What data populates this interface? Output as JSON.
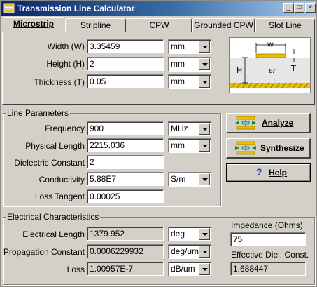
{
  "window": {
    "title": "Transmission Line Calculator",
    "controls": [
      "_",
      "□",
      "×"
    ]
  },
  "tabs": [
    {
      "label": "Microstrip",
      "active": true
    },
    {
      "label": "Stripline",
      "active": false
    },
    {
      "label": "CPW",
      "active": false
    },
    {
      "label": "Grounded CPW",
      "active": false
    },
    {
      "label": "Slot Line",
      "active": false
    }
  ],
  "geometry": {
    "width": {
      "label": "Width (W)",
      "value": "3.35459",
      "unit": "mm"
    },
    "height": {
      "label": "Height (H)",
      "value": "2",
      "unit": "mm"
    },
    "thickness": {
      "label": "Thickness (T)",
      "value": "0.05",
      "unit": "mm"
    }
  },
  "diagram": {
    "w_label": "W",
    "h_label": "H",
    "t_label": "T",
    "er_label": "εr"
  },
  "line_params": {
    "title": "Line Parameters",
    "frequency": {
      "label": "Frequency",
      "value": "900",
      "unit": "MHz"
    },
    "physical_length": {
      "label": "Physical Length",
      "value": "2215.036",
      "unit": "mm"
    },
    "dielectric_constant": {
      "label": "Dielectric Constant",
      "value": "2"
    },
    "conductivity": {
      "label": "Conductivity",
      "value": "5.88E7",
      "unit": "S/m"
    },
    "loss_tangent": {
      "label": "Loss Tangent",
      "value": "0.00025"
    }
  },
  "buttons": {
    "analyze": "Analyze",
    "synthesize": "Synthesize",
    "help": "Help",
    "help_glyph": "?"
  },
  "electrical": {
    "title": "Electrical Characteristics",
    "electrical_length": {
      "label": "Electrical Length",
      "value": "1379.952",
      "unit": "deg"
    },
    "propagation_constant": {
      "label": "Propagation Constant",
      "value": "0.0006229932",
      "unit": "deg/um"
    },
    "loss": {
      "label": "Loss",
      "value": "1.00957E-7",
      "unit": "dB/um"
    },
    "impedance": {
      "label": "Impedance (Ohms)",
      "value": "75"
    },
    "eff_diel": {
      "label": "Effective Diel. Const.",
      "value": "1.688447"
    }
  }
}
